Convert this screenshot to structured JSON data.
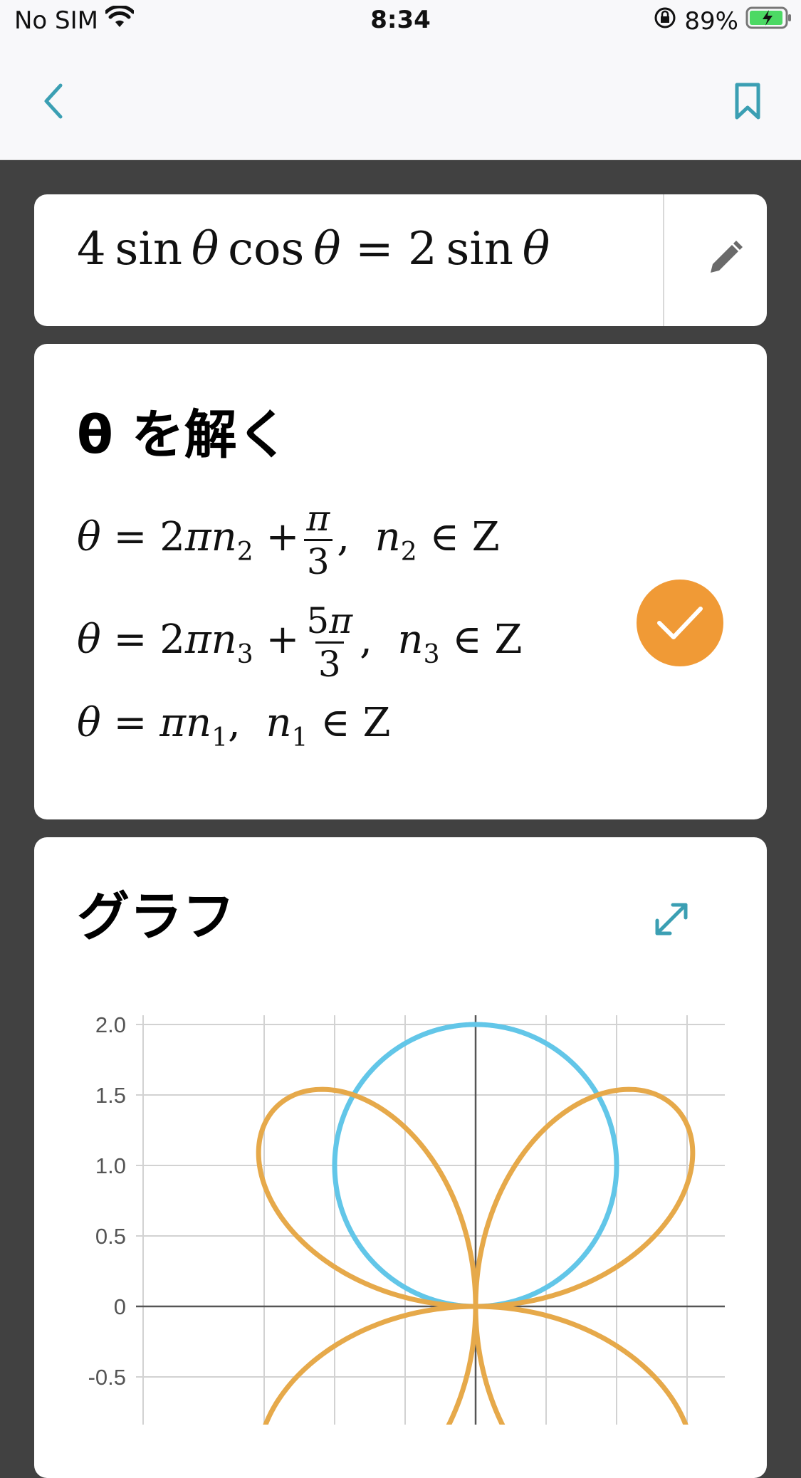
{
  "status_bar": {
    "carrier": "No SIM",
    "time": "8:34",
    "battery": "89%"
  },
  "nav": {
    "back_icon": "chevron-left-icon",
    "bookmark_icon": "bookmark-icon",
    "accent": "#3b9fb3"
  },
  "problem": {
    "edit_icon": "pencil-icon"
  },
  "solve": {
    "title": "θ を解く",
    "check_icon": "checkmark-icon",
    "badge_color": "#f09a36"
  },
  "graph": {
    "title": "グラフ",
    "expand_icon": "expand-arrows-icon"
  },
  "chart_data": {
    "type": "line",
    "title": "",
    "xlabel": "",
    "ylabel": "",
    "grid": true,
    "x_gridlines": [
      -1.5,
      -1,
      -0.5,
      0,
      0.5,
      1,
      1.5
    ],
    "ylim": [
      -0.5,
      2.0
    ],
    "ytick_labels": [
      "2.0",
      "1.5",
      "1.0",
      "0.5",
      "0",
      "-0.5"
    ],
    "series": [
      {
        "polar_equation": "r = 2 sin θ",
        "color": "#62c6e8"
      },
      {
        "polar_equation": "r = 4 sin θ cos θ",
        "color": "#e6a94a"
      }
    ]
  }
}
